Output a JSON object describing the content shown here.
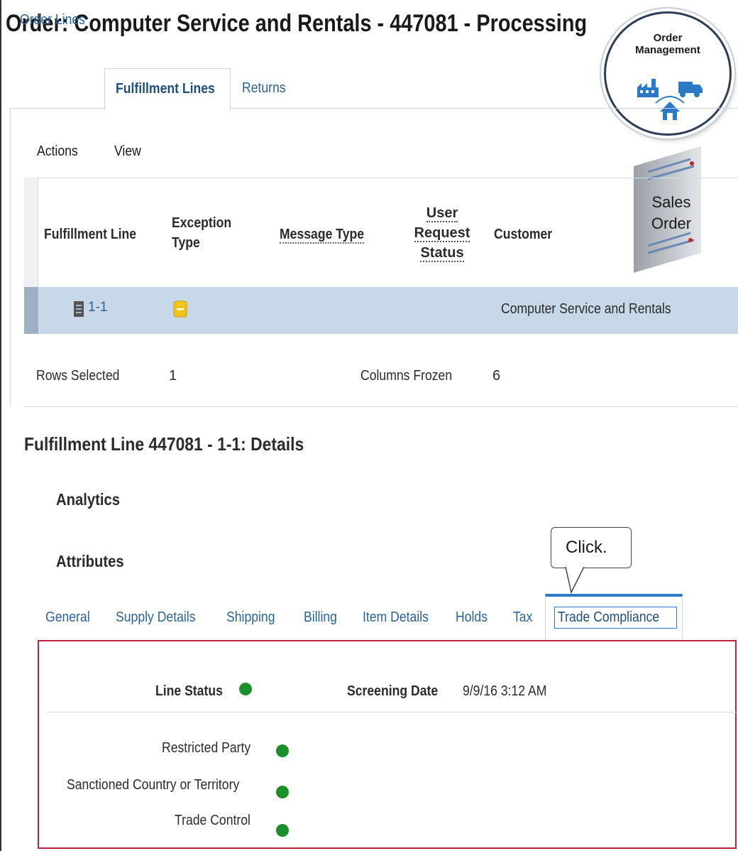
{
  "page": {
    "title": "Order: Computer Service and Rentals - 447081 - Processing"
  },
  "tabs": [
    {
      "label": "Order Lines"
    },
    {
      "label": "Fulfillment Lines"
    },
    {
      "label": "Returns"
    }
  ],
  "toolbar": {
    "actions_label": "Actions",
    "view_label": "View"
  },
  "table": {
    "columns": [
      {
        "label": "Fulfillment Line"
      },
      {
        "label_lines": [
          "Exception",
          "Type"
        ]
      },
      {
        "label": "Message Type"
      },
      {
        "label_lines": [
          "User",
          "Request",
          "Status"
        ]
      },
      {
        "label": "Customer"
      }
    ],
    "rows": [
      {
        "fulfillment_line": "1-1",
        "customer": "Computer Service and Rentals"
      }
    ]
  },
  "status": {
    "rows_selected_label": "Rows Selected",
    "rows_selected_value": "1",
    "columns_frozen_label": "Columns Frozen",
    "columns_frozen_value": "6"
  },
  "details": {
    "title": "Fulfillment Line 447081 - 1-1: Details",
    "analytics_label": "Analytics",
    "attributes_label": "Attributes",
    "sub_tabs": [
      {
        "label": "General"
      },
      {
        "label": "Supply Details"
      },
      {
        "label": "Shipping"
      },
      {
        "label": "Billing"
      },
      {
        "label": "Item Details"
      },
      {
        "label": "Holds"
      },
      {
        "label": "Tax"
      },
      {
        "label": "Trade Compliance"
      }
    ],
    "trade_compliance": {
      "line_status_label": "Line Status",
      "screening_date_label": "Screening Date",
      "screening_date_value": "9/9/16 3:12 AM",
      "restricted_party_label": "Restricted Party",
      "sanctioned_country_label": "Sanctioned Country or Territory",
      "trade_control_label": "Trade Control"
    }
  },
  "callout": {
    "text": "Click."
  },
  "badge": {
    "line1": "Order",
    "line2": "Management"
  },
  "sales_order": {
    "line1": "Sales",
    "line2": "Order"
  },
  "colors": {
    "link": "#2a6496",
    "selected_row": "#c7d8e8",
    "status_ok": "#1b8f2a",
    "highlight_border": "#c0223a",
    "exception_warning": "#f0c419"
  },
  "icons": [
    "document-icon",
    "exception-warning-icon",
    "status-green-icon",
    "factory-icon",
    "truck-icon",
    "home-icon"
  ]
}
